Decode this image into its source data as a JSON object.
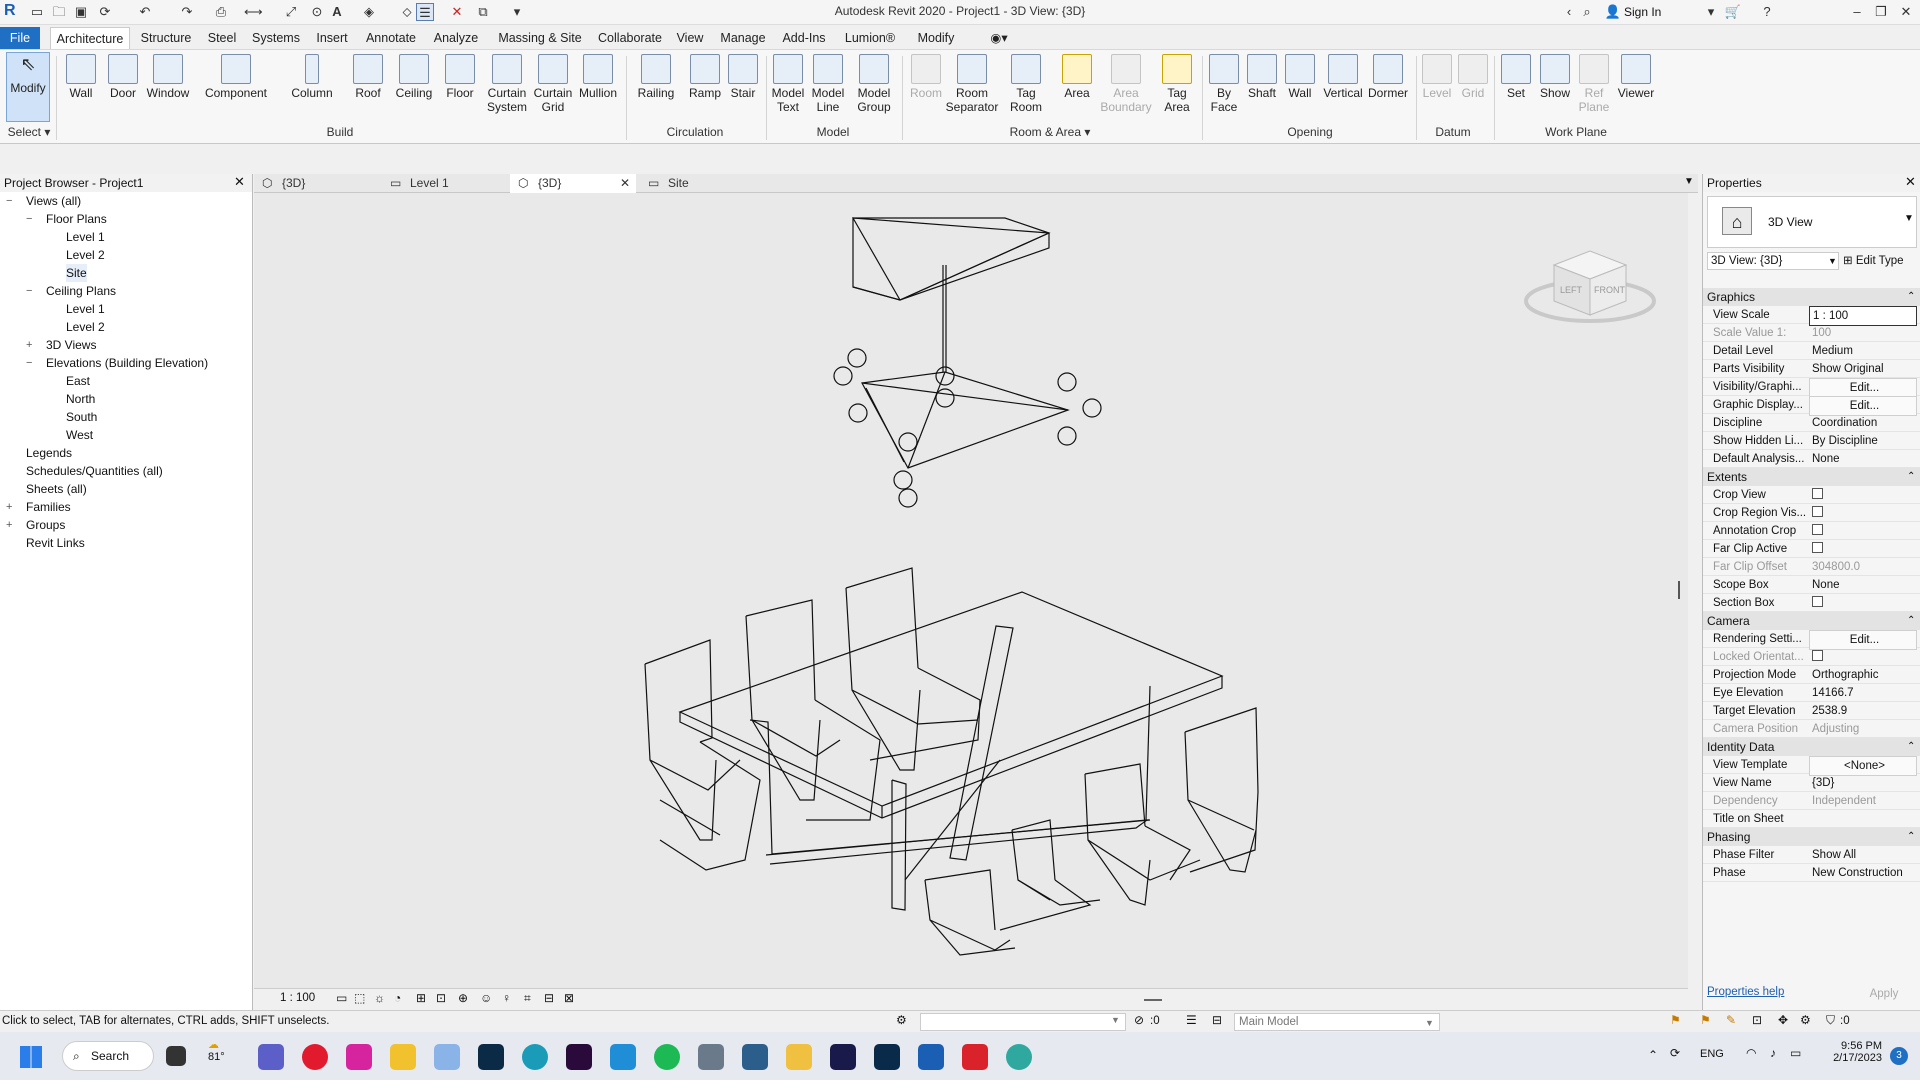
{
  "titlebar": {
    "title": "Autodesk Revit 2020 - Project1 - 3D View: {3D}",
    "sign_in": "Sign In",
    "app_logo": "R"
  },
  "menu_tabs": [
    "File",
    "Architecture",
    "Structure",
    "Steel",
    "Systems",
    "Insert",
    "Annotate",
    "Analyze",
    "Massing & Site",
    "Collaborate",
    "View",
    "Manage",
    "Add-Ins",
    "Lumion®",
    "Modify"
  ],
  "ribbon": {
    "select_label": "Select",
    "build": {
      "group": "Build",
      "buttons": [
        "Modify",
        "Wall",
        "Door",
        "Window",
        "Component",
        "Column",
        "Roof",
        "Ceiling",
        "Floor",
        "Curtain System",
        "Curtain Grid",
        "Mullion"
      ]
    },
    "circulation": {
      "group": "Circulation",
      "buttons": [
        "Railing",
        "Ramp",
        "Stair"
      ]
    },
    "model": {
      "group": "Model",
      "buttons": [
        "Model Text",
        "Model Line",
        "Model Group"
      ]
    },
    "room_area": {
      "group": "Room & Area",
      "buttons": [
        "Room",
        "Room Separator",
        "Tag Room",
        "Area",
        "Area Boundary",
        "Tag Area"
      ]
    },
    "opening": {
      "group": "Opening",
      "buttons": [
        "By Face",
        "Shaft",
        "Wall",
        "Vertical",
        "Dormer"
      ]
    },
    "datum": {
      "group": "Datum",
      "buttons": [
        "Level",
        "Grid"
      ]
    },
    "work_plane": {
      "group": "Work Plane",
      "buttons": [
        "Set",
        "Show",
        "Ref Plane",
        "Viewer"
      ]
    }
  },
  "project_browser": {
    "title": "Project Browser - Project1",
    "items": [
      {
        "label": "Views (all)",
        "depth": 0,
        "toggle": "−"
      },
      {
        "label": "Floor Plans",
        "depth": 1,
        "toggle": "−"
      },
      {
        "label": "Level 1",
        "depth": 2,
        "toggle": ""
      },
      {
        "label": "Level 2",
        "depth": 2,
        "toggle": ""
      },
      {
        "label": "Site",
        "depth": 2,
        "toggle": ""
      },
      {
        "label": "Ceiling Plans",
        "depth": 1,
        "toggle": "−"
      },
      {
        "label": "Level 1",
        "depth": 2,
        "toggle": ""
      },
      {
        "label": "Level 2",
        "depth": 2,
        "toggle": ""
      },
      {
        "label": "3D Views",
        "depth": 1,
        "toggle": "+"
      },
      {
        "label": "Elevations (Building Elevation)",
        "depth": 1,
        "toggle": "−"
      },
      {
        "label": "East",
        "depth": 2,
        "toggle": ""
      },
      {
        "label": "North",
        "depth": 2,
        "toggle": ""
      },
      {
        "label": "South",
        "depth": 2,
        "toggle": ""
      },
      {
        "label": "West",
        "depth": 2,
        "toggle": ""
      },
      {
        "label": "Legends",
        "depth": 0,
        "toggle": ""
      },
      {
        "label": "Schedules/Quantities (all)",
        "depth": 0,
        "toggle": ""
      },
      {
        "label": "Sheets (all)",
        "depth": 0,
        "toggle": ""
      },
      {
        "label": "Families",
        "depth": 0,
        "toggle": "+"
      },
      {
        "label": "Groups",
        "depth": 0,
        "toggle": "+"
      },
      {
        "label": "Revit Links",
        "depth": 0,
        "toggle": ""
      }
    ]
  },
  "view_tabs": [
    "{3D}",
    "Level 1",
    "{3D}",
    "Site"
  ],
  "viewcube": {
    "left": "LEFT",
    "front": "FRONT"
  },
  "view_control_bar": {
    "scale": "1 : 100"
  },
  "properties": {
    "title": "Properties",
    "type_name": "3D View",
    "selector": "3D View: {3D}",
    "edit_type": "Edit Type",
    "sections": [
      {
        "name": "Graphics",
        "rows": [
          {
            "k": "View Scale",
            "v": "1 : 100"
          },
          {
            "k": "Scale Value    1:",
            "v": "100"
          },
          {
            "k": "Detail Level",
            "v": "Medium"
          },
          {
            "k": "Parts Visibility",
            "v": "Show Original"
          },
          {
            "k": "Visibility/Graphi...",
            "v": "Edit..."
          },
          {
            "k": "Graphic Display...",
            "v": "Edit..."
          },
          {
            "k": "Discipline",
            "v": "Coordination"
          },
          {
            "k": "Show Hidden Li...",
            "v": "By Discipline"
          },
          {
            "k": "Default Analysis...",
            "v": "None"
          }
        ]
      },
      {
        "name": "Extents",
        "rows": [
          {
            "k": "Crop View",
            "v": "☐"
          },
          {
            "k": "Crop Region Vis...",
            "v": "☐"
          },
          {
            "k": "Annotation Crop",
            "v": "☐"
          },
          {
            "k": "Far Clip Active",
            "v": "☐"
          },
          {
            "k": "Far Clip Offset",
            "v": "304800.0"
          },
          {
            "k": "Scope Box",
            "v": "None"
          },
          {
            "k": "Section Box",
            "v": "☐"
          }
        ]
      },
      {
        "name": "Camera",
        "rows": [
          {
            "k": "Rendering Setti...",
            "v": "Edit..."
          },
          {
            "k": "Locked Orientat...",
            "v": "☐"
          },
          {
            "k": "Projection Mode",
            "v": "Orthographic"
          },
          {
            "k": "Eye Elevation",
            "v": "14166.7"
          },
          {
            "k": "Target Elevation",
            "v": "2538.9"
          },
          {
            "k": "Camera Position",
            "v": "Adjusting"
          }
        ]
      },
      {
        "name": "Identity Data",
        "rows": [
          {
            "k": "View Template",
            "v": "<None>"
          },
          {
            "k": "View Name",
            "v": "{3D}"
          },
          {
            "k": "Dependency",
            "v": "Independent"
          },
          {
            "k": "Title on Sheet",
            "v": ""
          }
        ]
      },
      {
        "name": "Phasing",
        "rows": [
          {
            "k": "Phase Filter",
            "v": "Show All"
          },
          {
            "k": "Phase",
            "v": "New Construction"
          }
        ]
      }
    ],
    "help": "Properties help",
    "apply": "Apply"
  },
  "statusbar": {
    "hint": "Click to select, TAB for alternates, CTRL adds, SHIFT unselects.",
    "count": ":0",
    "workset": "Main Model",
    "filter": ":0"
  },
  "taskbar": {
    "search": "Search",
    "temp": "81°",
    "lang": "ENG",
    "time": "9:56 PM",
    "date": "2/17/2023",
    "notif": "3"
  }
}
